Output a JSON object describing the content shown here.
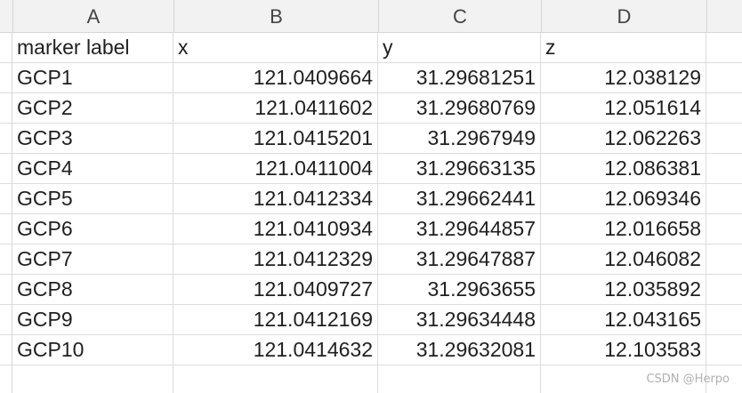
{
  "columns": [
    "A",
    "B",
    "C",
    "D"
  ],
  "header_row": [
    "marker label",
    "x",
    "y",
    "z"
  ],
  "rows": [
    [
      "GCP1",
      "121.0409664",
      "31.29681251",
      "12.038129"
    ],
    [
      "GCP2",
      "121.0411602",
      "31.29680769",
      "12.051614"
    ],
    [
      "GCP3",
      "121.0415201",
      "31.2967949",
      "12.062263"
    ],
    [
      "GCP4",
      "121.0411004",
      "31.29663135",
      "12.086381"
    ],
    [
      "GCP5",
      "121.0412334",
      "31.29662441",
      "12.069346"
    ],
    [
      "GCP6",
      "121.0410934",
      "31.29644857",
      "12.016658"
    ],
    [
      "GCP7",
      "121.0412329",
      "31.29647887",
      "12.046082"
    ],
    [
      "GCP8",
      "121.0409727",
      "31.2963655",
      "12.035892"
    ],
    [
      "GCP9",
      "121.0412169",
      "31.29634448",
      "12.043165"
    ],
    [
      "GCP10",
      "121.0414632",
      "31.29632081",
      "12.103583"
    ]
  ],
  "watermark": "CSDN @Herpo"
}
